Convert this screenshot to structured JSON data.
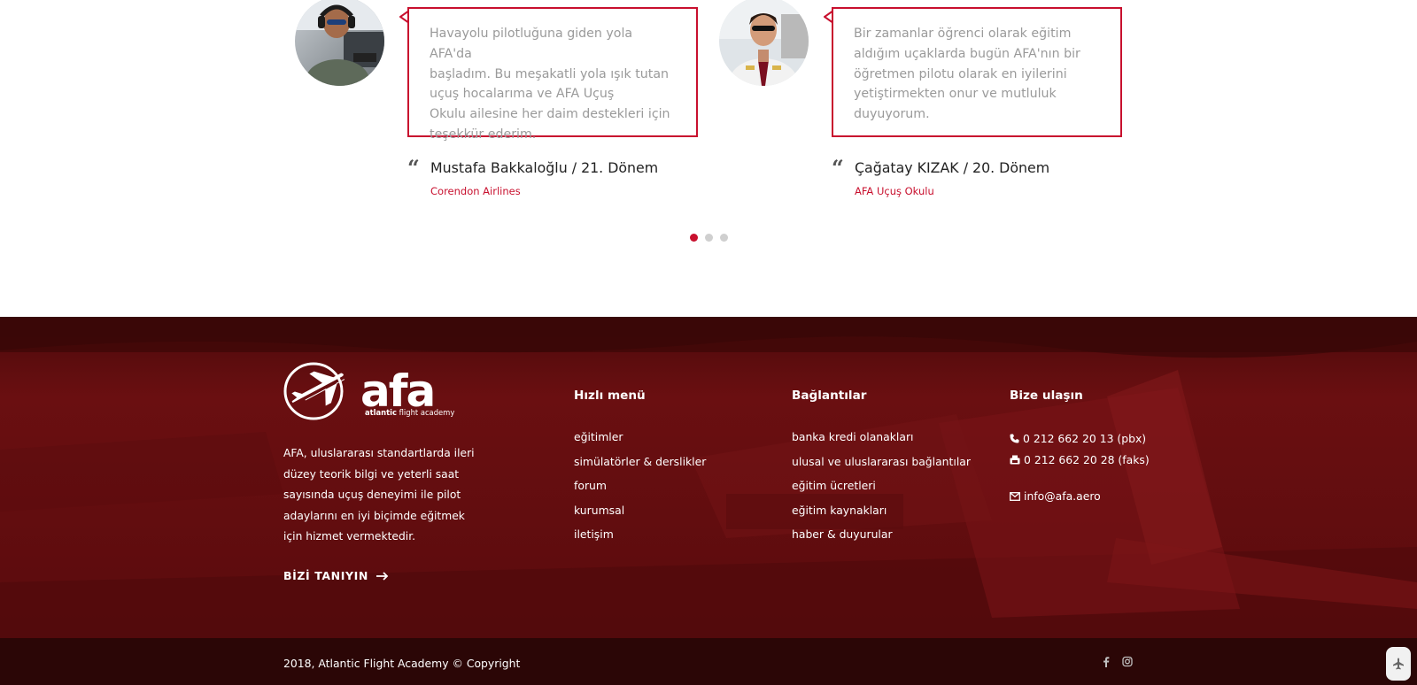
{
  "testimonials": [
    {
      "quote": "Havayolu pilotluğuna giden yola AFA'da\nbaşladım. Bu meşakatli yola ışık tutan\nuçuş hocalarıma ve AFA Uçuş\nOkulu ailesine her daim destekleri için\nteşekkür ederim.",
      "author": "Mustafa Bakkaloğlu / 21. Dönem",
      "company": "Corendon Airlines"
    },
    {
      "quote": "Bir zamanlar öğrenci olarak eğitim\naldığım uçaklarda bugün AFA'nın bir\nöğretmen pilotu olarak en iyilerini\nyetiştirmekten onur ve mutluluk\nduyuyorum.",
      "author": "Çağatay KIZAK / 20. Dönem",
      "company": "AFA Uçuş Okulu"
    }
  ],
  "carousel": {
    "page_count": 3,
    "active_index": 0
  },
  "footer": {
    "logo": {
      "wordmark": "afa",
      "tagline_bold": "atlantic",
      "tagline_rest": " flight academy"
    },
    "about": "AFA, uluslararası standartlarda ileri düzey teorik bilgi ve yeterli saat sayısında uçuş deneyimi ile pilot adaylarını en iyi biçimde eğitmek için hizmet vermektedir.",
    "about_link": "BİZİ TANIYIN",
    "quick_menu": {
      "title": "Hızlı menü",
      "items": [
        "eğitimler",
        "simülatörler & derslikler",
        "forum",
        "kurumsal",
        "iletişim"
      ]
    },
    "links": {
      "title": "Bağlantılar",
      "items": [
        "banka kredi olanakları",
        "ulusal ve uluslararası bağlantılar",
        "eğitim ücretleri",
        "eğitim kaynakları",
        "haber & duyurular"
      ]
    },
    "contact": {
      "title": "Bize ulaşın",
      "phone": "0 212 662 20 13 (pbx)",
      "fax": "0 212 662 20 28 (faks)",
      "email": "info@afa.aero"
    }
  },
  "bottom_bar": {
    "copyright": "2018, Atlantic Flight Academy © Copyright",
    "social_icons": [
      "facebook-icon",
      "instagram-icon"
    ],
    "to_top_icon": "airplane-icon"
  },
  "colors": {
    "accent": "#c8102e",
    "footer_bg": "#6b0e10",
    "bottom_bar_bg": "#2b0606",
    "quote_text": "#9a9a9a"
  }
}
